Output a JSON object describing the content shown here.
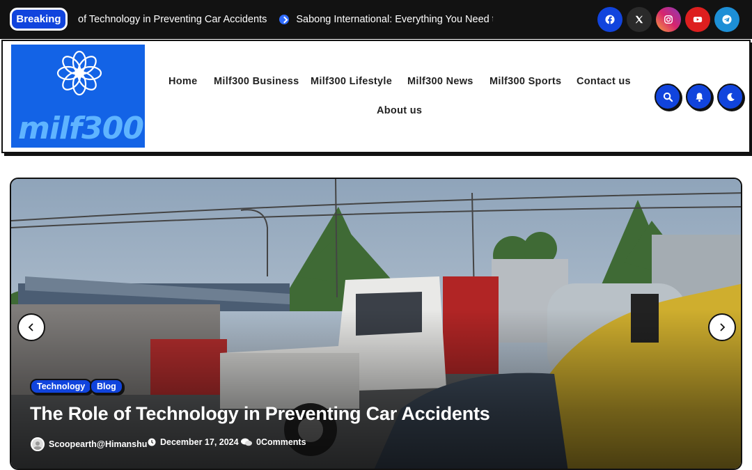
{
  "topbar": {
    "breaking_label": "Breaking",
    "ticker": [
      "of Technology in Preventing Car Accidents",
      "Sabong International: Everything You Need to Kn"
    ],
    "social": [
      {
        "icon": "facebook-icon",
        "color": "#1877f2"
      },
      {
        "icon": "x-twitter-icon",
        "color": "#222222"
      },
      {
        "icon": "instagram-icon",
        "color": "#c13584"
      },
      {
        "icon": "youtube-icon",
        "color": "#dd1f1f"
      },
      {
        "icon": "telegram-icon",
        "color": "#1d8fd6"
      }
    ]
  },
  "header": {
    "logo_text": "milf300",
    "logo_bg": "#1363e6",
    "nav": [
      "Home",
      "Milf300 Business",
      "Milf300 Lifestyle",
      "Milf300 News",
      "Milf300 Sports",
      "Contact us",
      "About us"
    ],
    "buttons": [
      "search-icon",
      "bell-icon",
      "moon-icon"
    ],
    "accent": "#1144dd"
  },
  "slider": {
    "categories": [
      "Technology",
      "Blog"
    ],
    "title": "The Role of Technology in Preventing Car Accidents",
    "author": "Scoopearth@Himanshu",
    "date": "December 17, 2024",
    "comments": "0Comments"
  }
}
